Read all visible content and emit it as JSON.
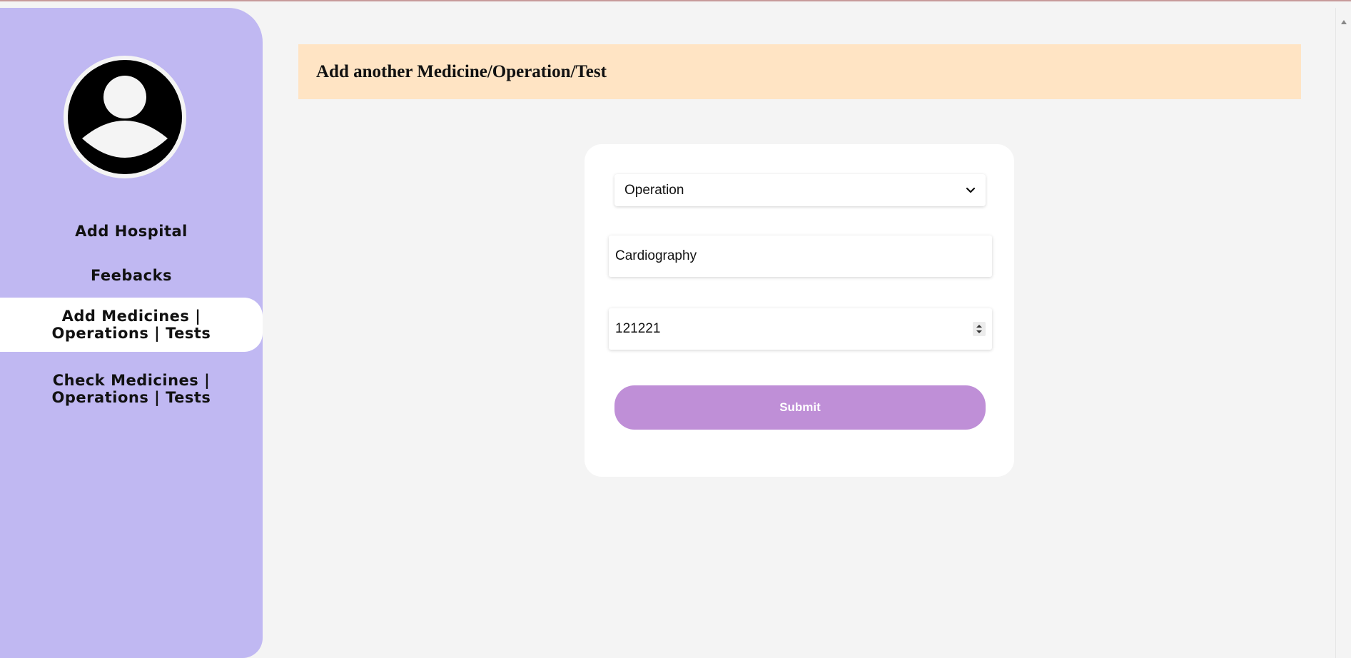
{
  "sidebar": {
    "items": [
      {
        "label": "Add Hospital"
      },
      {
        "label": "Feebacks"
      },
      {
        "label": "Add Medicines | Operations | Tests"
      },
      {
        "label": "Check Medicines | Operations | Tests"
      }
    ],
    "active_index": 2,
    "background_color": "#c0b8f2"
  },
  "header": {
    "title": "Add another Medicine/Operation/Test",
    "background_color": "#ffe4c4"
  },
  "form": {
    "type_select": {
      "value": "Operation"
    },
    "name_field": {
      "value": "Cardiography"
    },
    "price_field": {
      "value": "121221"
    },
    "submit_label": "Submit",
    "submit_color": "#bf8fd7"
  },
  "icons": {
    "avatar": "user-avatar-icon",
    "select_arrow": "chevron-down-icon",
    "stepper": "number-stepper-icon",
    "scroll_up": "scroll-up-arrow-icon"
  }
}
